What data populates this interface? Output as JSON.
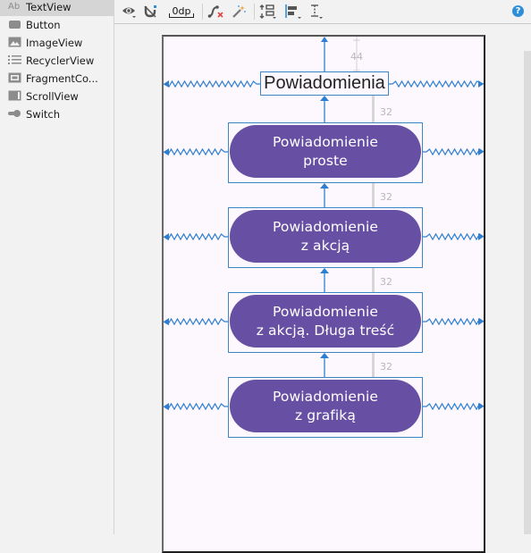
{
  "palette": {
    "items": [
      {
        "label": "TextView",
        "icon": "textview-icon",
        "selected": true
      },
      {
        "label": "Button",
        "icon": "button-icon",
        "selected": false
      },
      {
        "label": "ImageView",
        "icon": "imageview-icon",
        "selected": false
      },
      {
        "label": "RecyclerView",
        "icon": "recyclerview-icon",
        "selected": false
      },
      {
        "label": "FragmentCo...",
        "icon": "fragmentcontainer-icon",
        "selected": false
      },
      {
        "label": "ScrollView",
        "icon": "scrollview-icon",
        "selected": false
      },
      {
        "label": "Switch",
        "icon": "switch-icon",
        "selected": false
      }
    ],
    "textview_glyph": "Ab"
  },
  "toolbar": {
    "default_margin": "0dp",
    "help_glyph": "?",
    "buttons": [
      "view-options",
      "autoconnect-toggle",
      "default-margin",
      "clear-constraints",
      "infer-constraints",
      "pack",
      "align",
      "guidelines"
    ]
  },
  "layout": {
    "title": "Powiadomienia",
    "buttons": [
      {
        "line1": "Powiadomienie",
        "line2": "proste"
      },
      {
        "line1": "Powiadomienie",
        "line2": "z akcją"
      },
      {
        "line1": "Powiadomienie",
        "line2": "z akcją. Długa treść"
      },
      {
        "line1": "Powiadomienie",
        "line2": "z grafiką"
      }
    ],
    "margins": {
      "title_top": "44",
      "gap1": "32",
      "gap2": "32",
      "gap3": "32",
      "gap4": "32"
    },
    "colors": {
      "button": "#6750a4",
      "constraint": "#2f7fd0",
      "canvas_bg": "#fdf8fd",
      "selection": "#3d86c6"
    }
  }
}
